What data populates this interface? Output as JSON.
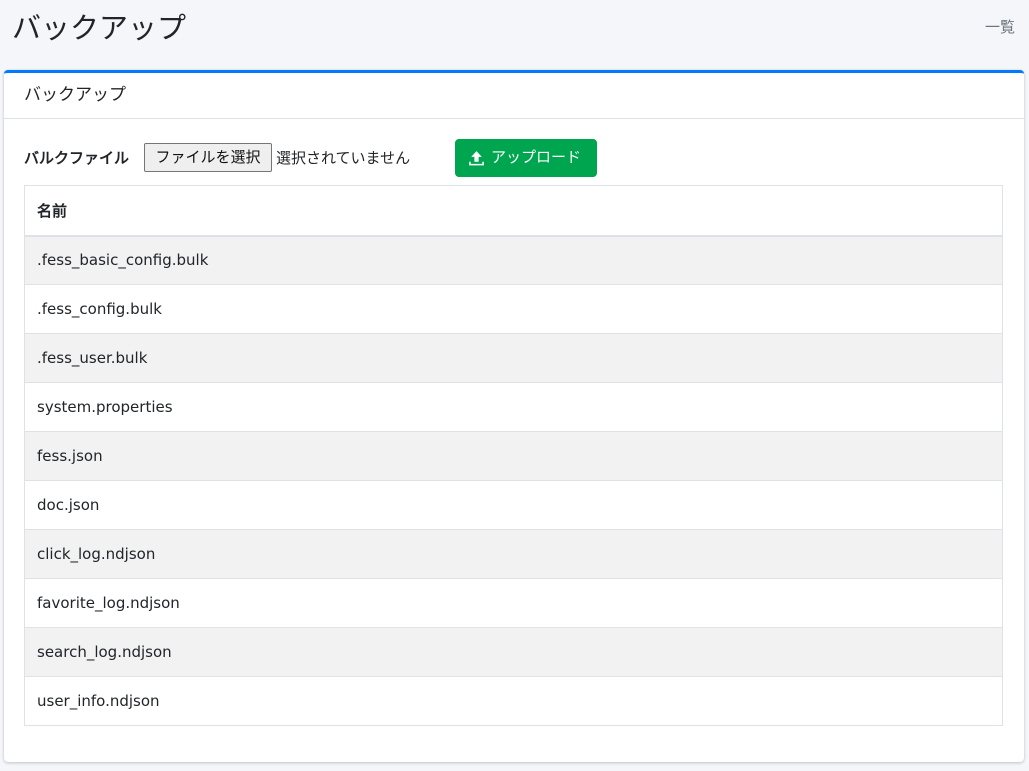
{
  "header": {
    "title": "バックアップ",
    "breadcrumb": "一覧"
  },
  "card": {
    "title": "バックアップ",
    "upload": {
      "label": "バルクファイル",
      "file_button": "ファイルを選択",
      "file_status": "選択されていません",
      "upload_button": "アップロード",
      "upload_icon": "upload-icon"
    },
    "table": {
      "header": "名前",
      "rows": [
        ".fess_basic_config.bulk",
        ".fess_config.bulk",
        ".fess_user.bulk",
        "system.properties",
        "fess.json",
        "doc.json",
        "click_log.ndjson",
        "favorite_log.ndjson",
        "search_log.ndjson",
        "user_info.ndjson"
      ]
    }
  },
  "colors": {
    "accent": "#007bff",
    "success": "#00a64f",
    "background": "#f4f6f9"
  }
}
